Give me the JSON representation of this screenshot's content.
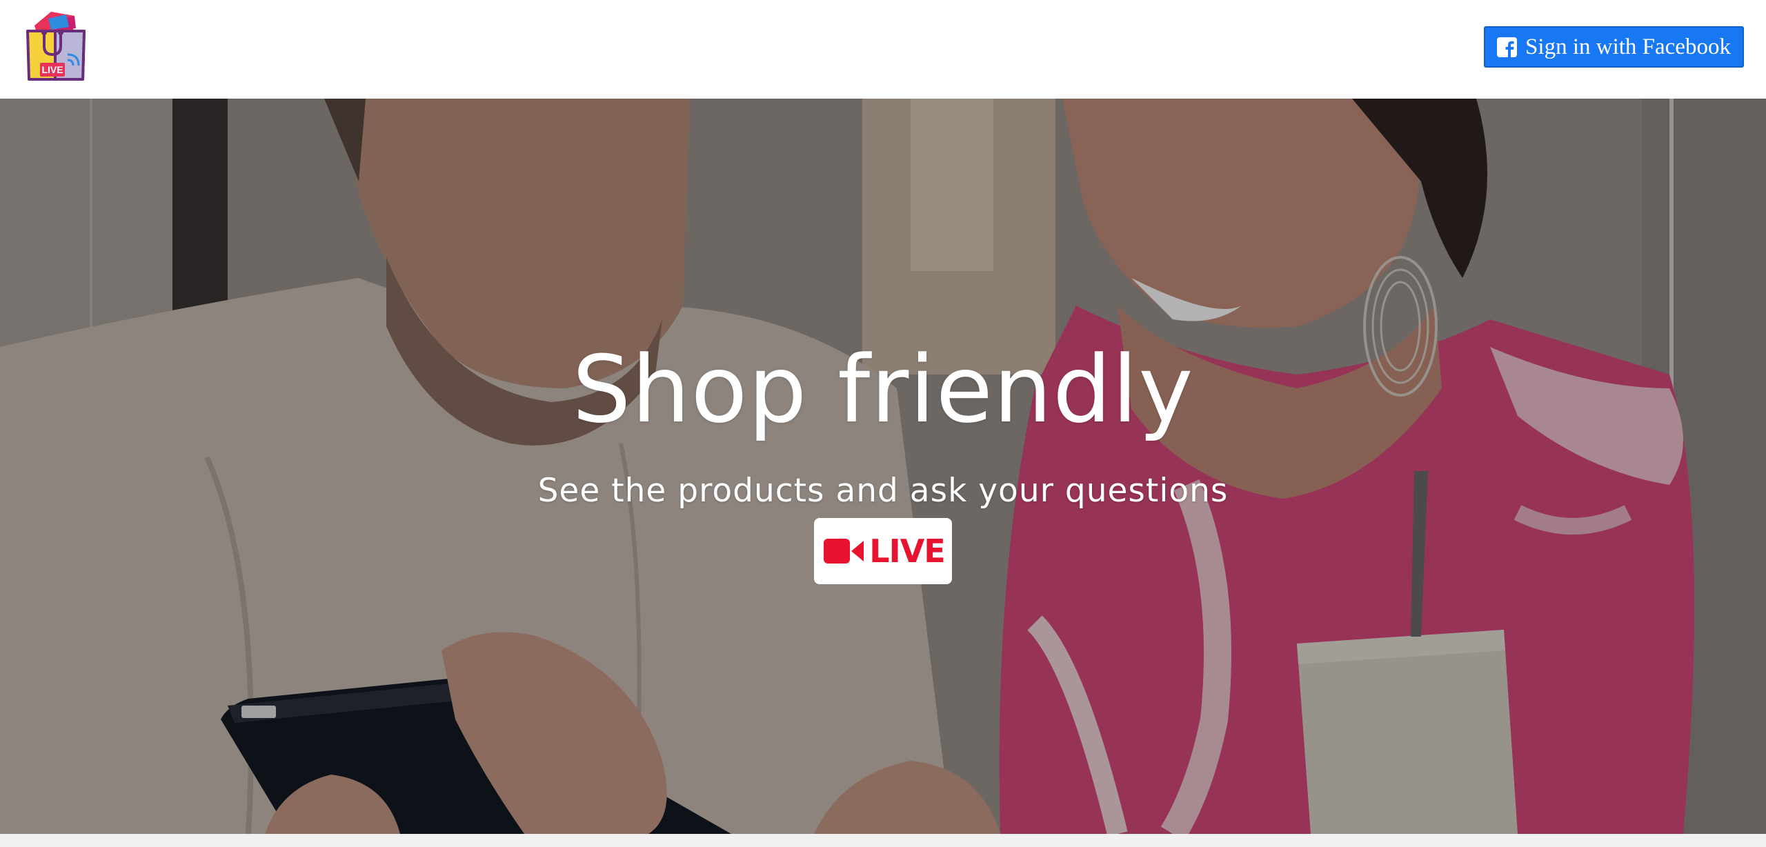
{
  "header": {
    "logo_icon": "shopping-bag-live-logo-icon",
    "logo_badge_text": "LIVE",
    "facebook_button": {
      "label": "Sign in with Facebook",
      "icon": "facebook-square-icon",
      "color": "#1877f2"
    }
  },
  "hero": {
    "background": "photo-two-people-looking-at-tablet",
    "title": "Shop friendly",
    "subtitle": "See the products and ask your questions",
    "live_button": {
      "icon": "video-camera-icon",
      "label": "LIVE",
      "color": "#e8132e"
    }
  }
}
